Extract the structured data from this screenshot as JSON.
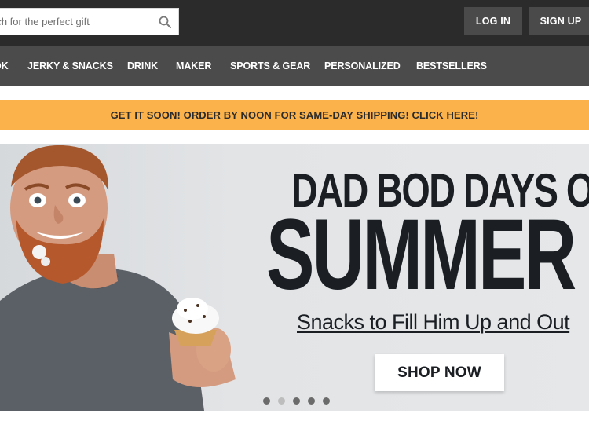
{
  "header": {
    "search": {
      "placeholder": "rch for the perfect gift",
      "value": ""
    },
    "login_label": "LOG IN",
    "signup_label": "SIGN UP"
  },
  "nav": {
    "items": [
      {
        "label": "OK"
      },
      {
        "label": "JERKY & SNACKS"
      },
      {
        "label": "DRINK"
      },
      {
        "label": "MAKER"
      },
      {
        "label": "SPORTS & GEAR"
      },
      {
        "label": "PERSONALIZED"
      },
      {
        "label": "BESTSELLERS"
      }
    ]
  },
  "promo": {
    "text": "GET IT SOON! ORDER BY NOON FOR SAME-DAY SHIPPING! CLICK HERE!"
  },
  "hero": {
    "headline_1": "DAD BOD DAYS OF",
    "headline_2": "SUMMER",
    "subline": "Snacks to Fill Him Up and Out",
    "cta_label": "SHOP NOW",
    "slides_total": 5,
    "active_slide": 2
  },
  "colors": {
    "topbar": "#2b2b2b",
    "navbar": "#4b4b4b",
    "promo": "#fbb24b",
    "text_dark": "#1b1f24"
  }
}
